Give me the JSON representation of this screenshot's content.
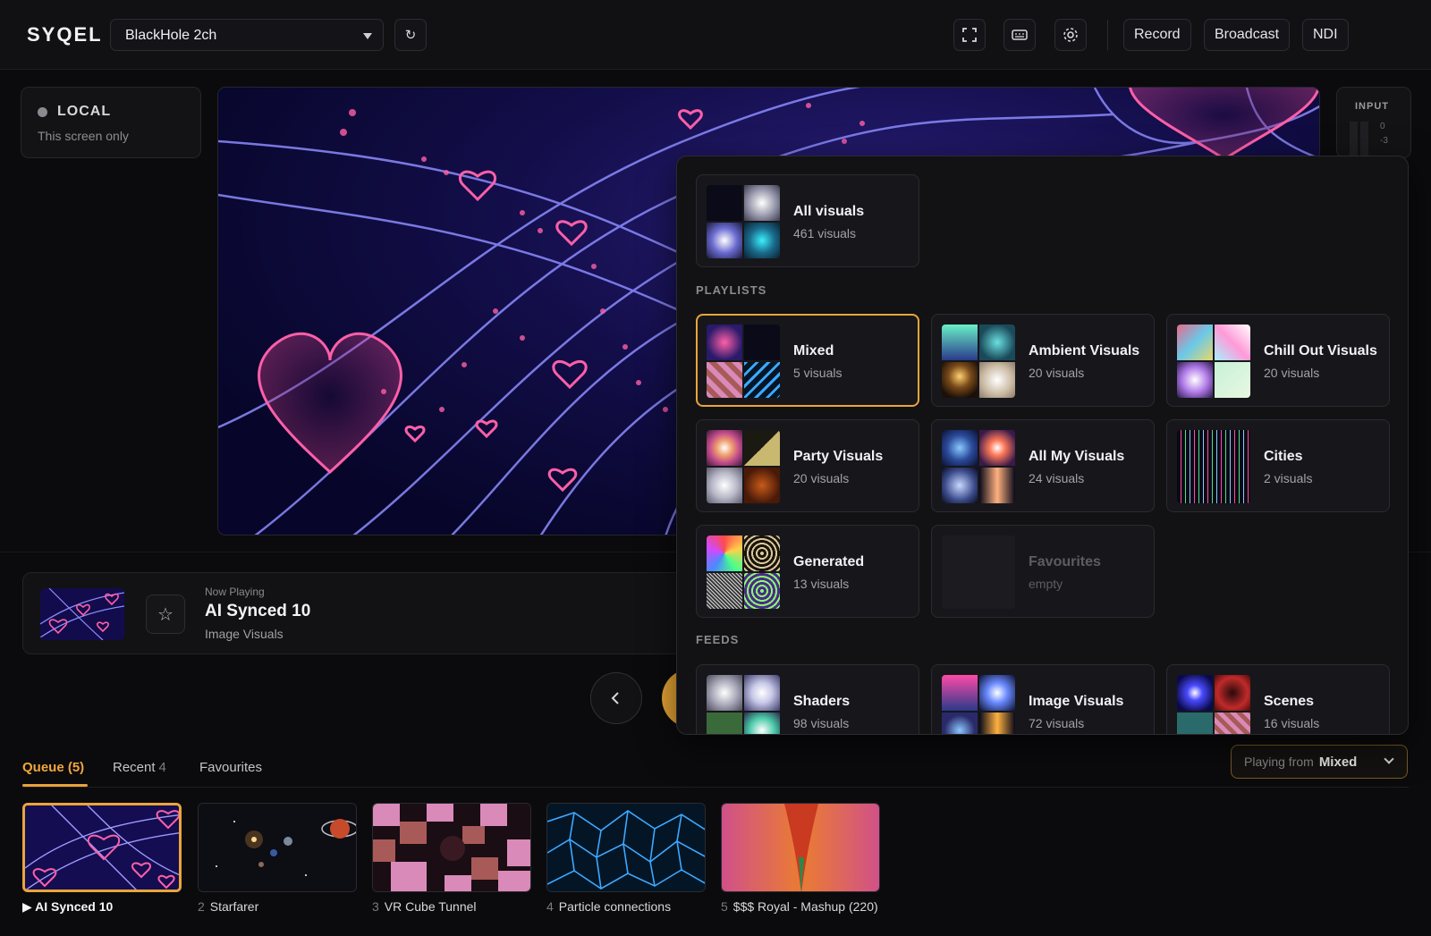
{
  "header": {
    "logo": "SYQEL",
    "device": "BlackHole 2ch",
    "buttons": [
      "Record",
      "Broadcast",
      "NDI"
    ]
  },
  "local": {
    "title": "LOCAL",
    "subtitle": "This screen only"
  },
  "input": {
    "title": "INPUT",
    "ticks": [
      "0",
      "-3"
    ]
  },
  "now_playing": {
    "label": "Now Playing",
    "title": "AI Synced 10",
    "source": "Image Visuals"
  },
  "tabs": {
    "queue": "Queue (5)",
    "recent": "Recent",
    "recent_count": "4",
    "favourites": "Favourites"
  },
  "playing_from": {
    "label": "Playing from",
    "value": "Mixed"
  },
  "queue": [
    {
      "num": "",
      "title": "AI Synced 10",
      "current": true
    },
    {
      "num": "2",
      "title": "Starfarer"
    },
    {
      "num": "3",
      "title": "VR Cube Tunnel"
    },
    {
      "num": "4",
      "title": "Particle connections"
    },
    {
      "num": "5",
      "title": "$$$ Royal - Mashup (220)"
    }
  ],
  "library": {
    "all": {
      "title": "All visuals",
      "sub": "461 visuals"
    },
    "playlists_label": "PLAYLISTS",
    "playlists": [
      {
        "title": "Mixed",
        "sub": "5 visuals"
      },
      {
        "title": "Ambient Visuals",
        "sub": "20 visuals"
      },
      {
        "title": "Chill Out Visuals",
        "sub": "20 visuals"
      },
      {
        "title": "Party Visuals",
        "sub": "20 visuals"
      },
      {
        "title": "All My Visuals",
        "sub": "24 visuals"
      },
      {
        "title": "Cities",
        "sub": "2 visuals"
      },
      {
        "title": "Generated",
        "sub": "13 visuals"
      },
      {
        "title": "Favourites",
        "sub": "empty"
      }
    ],
    "feeds_label": "FEEDS",
    "feeds": [
      {
        "title": "Shaders",
        "sub": "98 visuals"
      },
      {
        "title": "Image Visuals",
        "sub": "72 visuals"
      },
      {
        "title": "Scenes",
        "sub": "16 visuals"
      }
    ]
  },
  "colors": {
    "accent": "#eaa53a",
    "background": "#0b0b0d",
    "panel": "#121215"
  }
}
